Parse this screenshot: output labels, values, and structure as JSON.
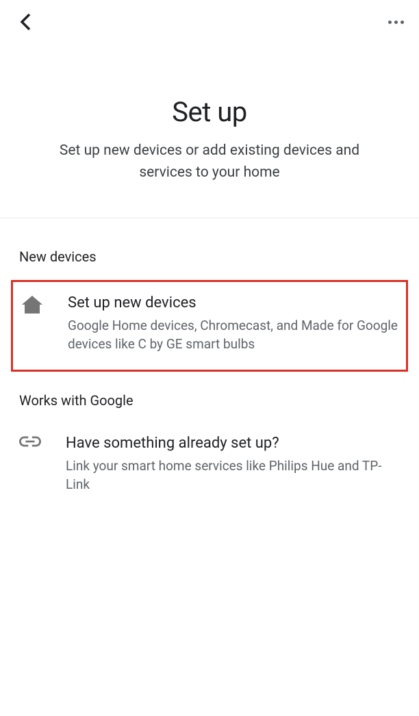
{
  "header": {
    "title": "Set up",
    "subtitle": "Set up new devices or add existing devices and services to your home"
  },
  "sections": {
    "new_devices": {
      "label": "New devices",
      "item": {
        "title": "Set up new devices",
        "desc": "Google Home devices, Chromecast, and Made for Google devices like C by GE smart bulbs"
      }
    },
    "works_with": {
      "label": "Works with Google",
      "item": {
        "title": "Have something already set up?",
        "desc": "Link your smart home services like Philips Hue and TP-Link"
      }
    }
  }
}
